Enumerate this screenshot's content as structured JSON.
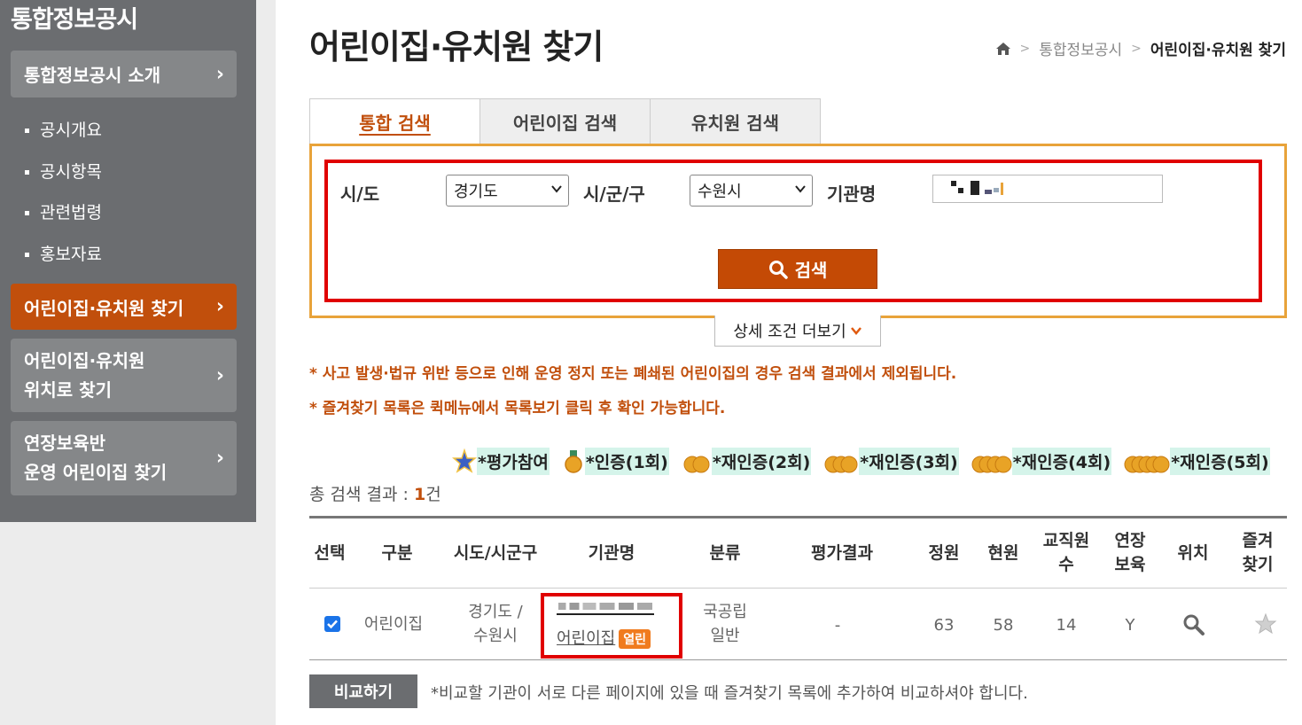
{
  "sidebar": {
    "title": "통합정보공시",
    "intro": {
      "label": "통합정보공시 소개"
    },
    "sub_items": [
      "공시개요",
      "공시항목",
      "관련법령",
      "홍보자료"
    ],
    "find": {
      "label": "어린이집·유치원 찾기"
    },
    "find_by_location": {
      "line1": "어린이집·유치원",
      "line2": "위치로 찾기"
    },
    "extended_care": {
      "line1": "연장보육반",
      "line2": "운영 어린이집 찾기"
    }
  },
  "main": {
    "title": "어린이집·유치원 찾기",
    "breadcrumb": {
      "home_icon": "home-icon",
      "level1": "통합정보공시",
      "current": "어린이집·유치원 찾기"
    },
    "tabs": [
      "통합 검색",
      "어린이집 검색",
      "유치원 검색"
    ],
    "active_tab": 0,
    "search": {
      "sido_label": "시/도",
      "sido_value": "경기도",
      "sigungu_label": "시/군/구",
      "sigungu_value": "수원시",
      "name_label": "기관명",
      "search_button": "검색",
      "more_button": "상세 조건 더보기"
    },
    "notices": [
      "* 사고 발생·법규 위반 등으로 인해 운영 정지 또는 폐쇄된 어린이집의 경우 검색 결과에서 제외됩니다.",
      "* 즐겨찾기 목록은 퀵메뉴에서 목록보기 클릭 후 확인 가능합니다."
    ],
    "legend": [
      "*평가참여",
      "*인증(1회)",
      "*재인증(2회)",
      "*재인증(3회)",
      "*재인증(4회)",
      "*재인증(5회)"
    ],
    "total": {
      "prefix": "총 검색 결과 : ",
      "count": "1",
      "suffix": "건"
    },
    "table": {
      "headers": {
        "select": "선택",
        "type": "구분",
        "region": "시도/시군구",
        "name": "기관명",
        "category": "분류",
        "eval": "평가결과",
        "capacity": "정원",
        "current": "현원",
        "staff1": "교직원",
        "staff2": "수",
        "ext1": "연장",
        "ext2": "보육",
        "location": "위치",
        "fav1": "즐겨",
        "fav2": "찾기"
      },
      "row": {
        "type": "어린이집",
        "region1": "경기도 /",
        "region2": "수원시",
        "name_line2": "어린이집",
        "badge": "열린",
        "category1": "국공립",
        "category2": "일반",
        "eval": "-",
        "capacity": "63",
        "current": "58",
        "staff": "14",
        "extended": "Y"
      }
    },
    "compare_button": "비교하기",
    "compare_note": "*비교할 기관이 서로 다른 페이지에 있을 때 즐겨찾기 목록에 추가하여 비교하셔야 합니다."
  },
  "colors": {
    "accent": "#c14f0c",
    "sidebar": "#6b6d70",
    "highlight_border": "#e00000",
    "search_border": "#e8a33a"
  }
}
